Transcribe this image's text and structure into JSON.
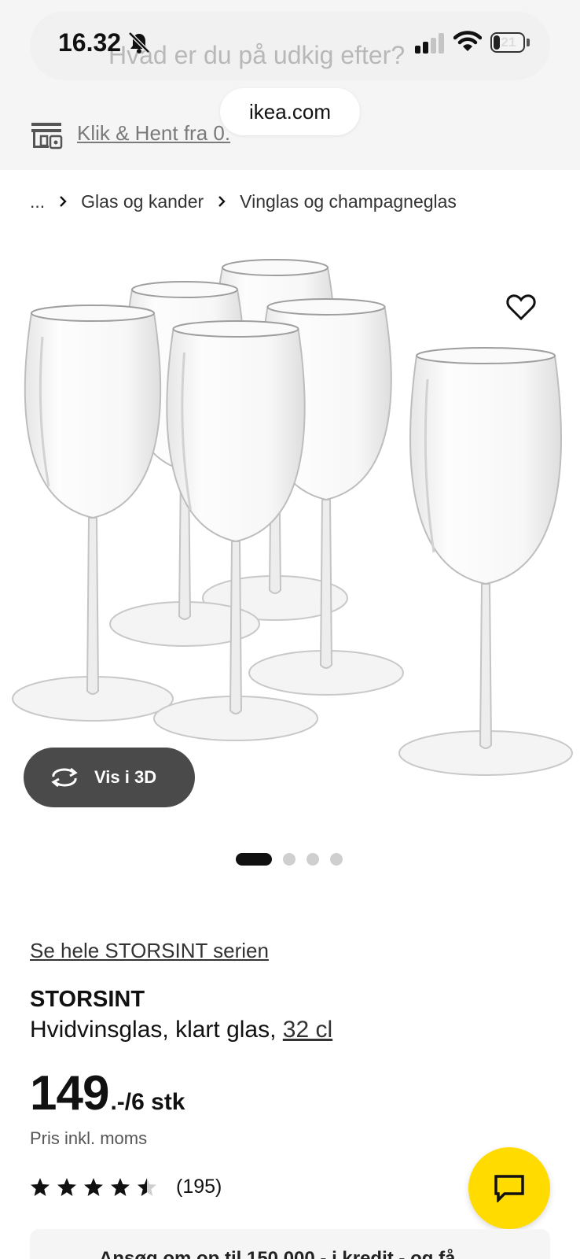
{
  "status_bar": {
    "time": "16.32",
    "battery_level": "21",
    "battery_fraction": 0.21
  },
  "search": {
    "placeholder": "Hvad er du på udkig efter?"
  },
  "browser": {
    "url": "ikea.com"
  },
  "collect": {
    "label": "Klik & Hent fra 0."
  },
  "breadcrumb": {
    "items": [
      "...",
      "Glas og kander",
      "Vinglas og champagneglas"
    ]
  },
  "gallery": {
    "view_3d_label": "Vis i 3D",
    "slide_count": 4,
    "active_slide": 1
  },
  "product": {
    "series_link": "Se hele STORSINT serien",
    "name": "STORSINT",
    "description": "Hvidvinsglas, klart glas, ",
    "size": "32 cl",
    "price": "149",
    "price_suffix": ".-/6 stk",
    "price_note": "Pris inkl. moms",
    "rating_value": 4.5,
    "rating_max": 5,
    "rating_count": "(195)"
  },
  "credit_banner": {
    "text": "Ansøg om op til 150.000,- i kredit - og få"
  },
  "colors": {
    "chat_button": "#ffdb00",
    "view_3d_button": "#4a4a4a",
    "header_background": "#f5f5f5"
  },
  "icons": [
    "bell-slash-icon",
    "signal-icon",
    "wifi-icon",
    "battery-icon",
    "store-icon",
    "chevron-right-icon",
    "heart-icon",
    "rotate-3d-icon",
    "star-icon",
    "chat-icon"
  ]
}
